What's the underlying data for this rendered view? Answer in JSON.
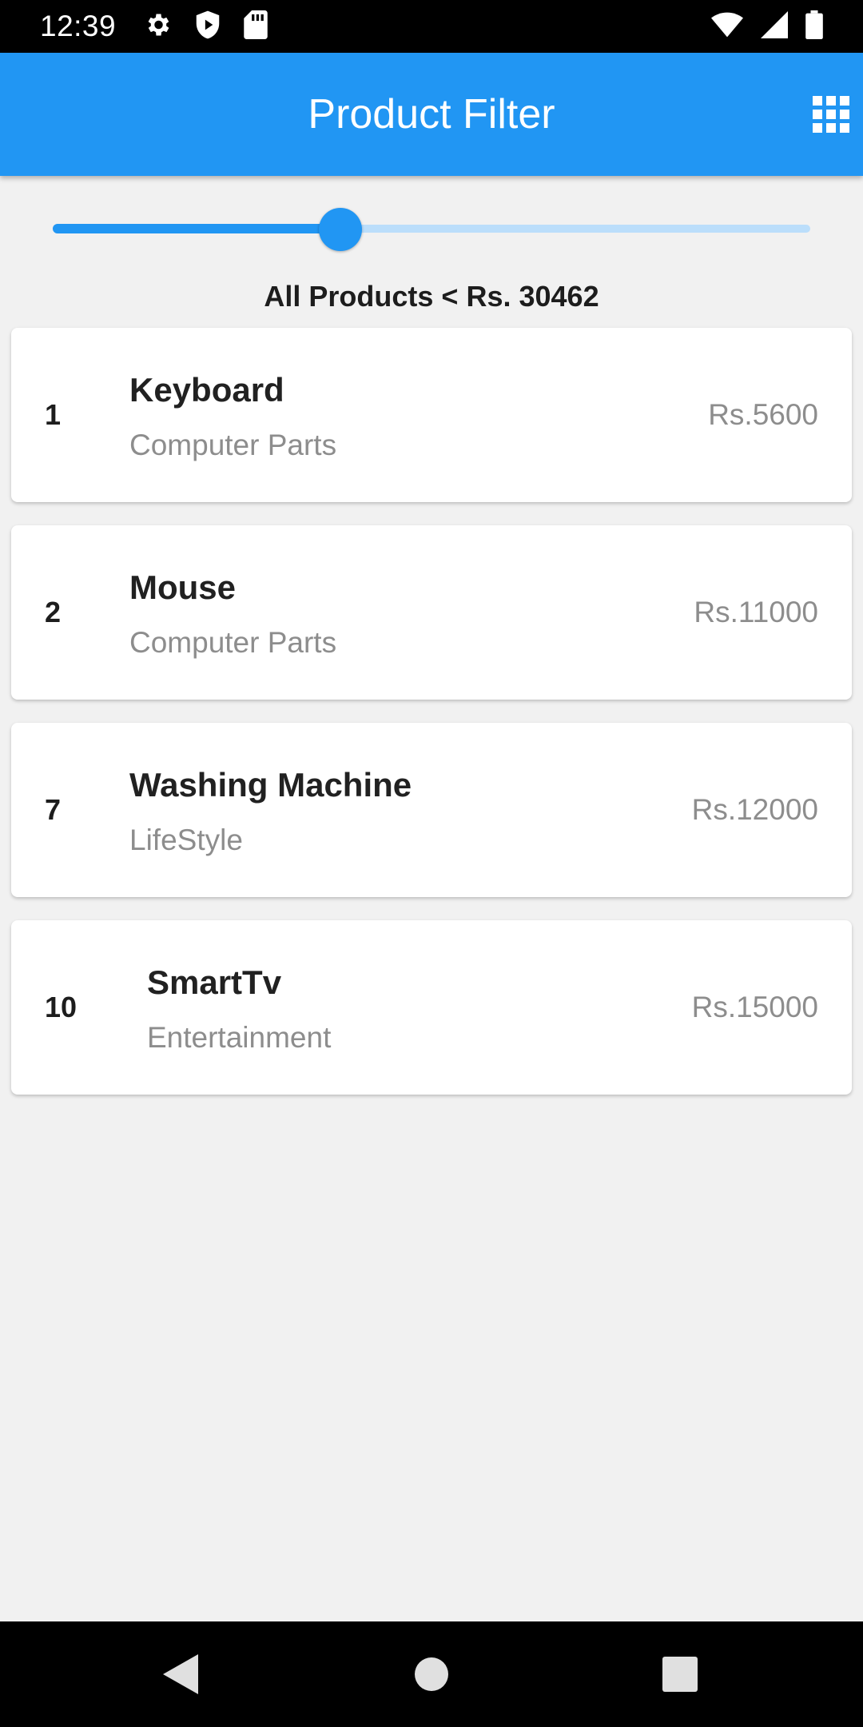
{
  "status_bar": {
    "time": "12:39",
    "left_icons": [
      "gear-icon",
      "play-shield-icon",
      "sd-card-icon"
    ],
    "right_icons": [
      "wifi-icon",
      "cell-signal-icon",
      "battery-icon"
    ]
  },
  "app_bar": {
    "title": "Product Filter",
    "action_icon": "grid-icon",
    "color": "#2196f3"
  },
  "price_slider": {
    "value_fraction": 0.38,
    "active_color": "#2196f3",
    "inactive_color": "#bbdefb"
  },
  "filter_label": "All Products < Rs. 30462",
  "products": [
    {
      "id": "1",
      "name": "Keyboard",
      "category": "Computer Parts",
      "price": "Rs.5600"
    },
    {
      "id": "2",
      "name": "Mouse",
      "category": "Computer Parts",
      "price": "Rs.11000"
    },
    {
      "id": "7",
      "name": "Washing Machine",
      "category": "LifeStyle",
      "price": "Rs.12000"
    },
    {
      "id": "10",
      "name": "SmartTv",
      "category": "Entertainment",
      "price": "Rs.15000"
    }
  ],
  "nav_bar": {
    "buttons": [
      "back-icon",
      "home-icon",
      "recents-icon"
    ]
  }
}
